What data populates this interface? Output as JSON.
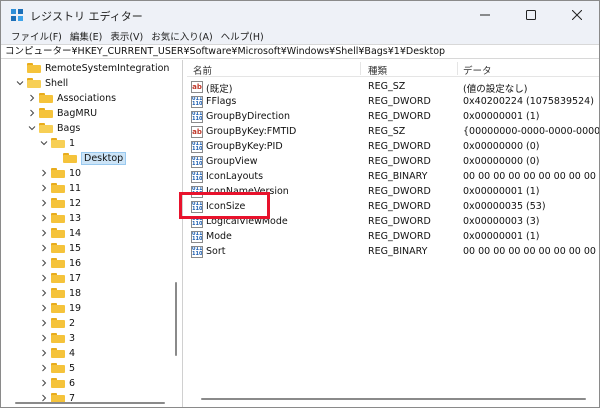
{
  "window": {
    "title": "レジストリ エディター"
  },
  "menu": [
    "ファイル(F)",
    "編集(E)",
    "表示(V)",
    "お気に入り(A)",
    "ヘルプ(H)"
  ],
  "address": "コンピューター¥HKEY_CURRENT_USER¥Software¥Microsoft¥Windows¥Shell¥Bags¥1¥Desktop",
  "tree": [
    {
      "label": "RemoteSystemIntegration",
      "expanded": false,
      "chevron": false
    },
    {
      "label": "Shell",
      "expanded": true,
      "chevron": true
    },
    {
      "label": "Associations",
      "expanded": false,
      "chevron": true
    },
    {
      "label": "BagMRU",
      "expanded": false,
      "chevron": true
    },
    {
      "label": "Bags",
      "expanded": true,
      "chevron": true
    },
    {
      "label": "1",
      "expanded": true,
      "chevron": true
    },
    {
      "label": "Desktop",
      "expanded": false,
      "chevron": false,
      "selected": true
    },
    {
      "label": "10",
      "expanded": false,
      "chevron": true
    },
    {
      "label": "11",
      "expanded": false,
      "chevron": true
    },
    {
      "label": "12",
      "expanded": false,
      "chevron": true
    },
    {
      "label": "13",
      "expanded": false,
      "chevron": true
    },
    {
      "label": "14",
      "expanded": false,
      "chevron": true
    },
    {
      "label": "15",
      "expanded": false,
      "chevron": true
    },
    {
      "label": "16",
      "expanded": false,
      "chevron": true
    },
    {
      "label": "17",
      "expanded": false,
      "chevron": true
    },
    {
      "label": "18",
      "expanded": false,
      "chevron": true
    },
    {
      "label": "19",
      "expanded": false,
      "chevron": true
    },
    {
      "label": "2",
      "expanded": false,
      "chevron": true
    },
    {
      "label": "3",
      "expanded": false,
      "chevron": true
    },
    {
      "label": "4",
      "expanded": false,
      "chevron": true
    },
    {
      "label": "5",
      "expanded": false,
      "chevron": true
    },
    {
      "label": "6",
      "expanded": false,
      "chevron": true
    },
    {
      "label": "7",
      "expanded": false,
      "chevron": true
    }
  ],
  "columns": {
    "name": "名前",
    "type": "種類",
    "data": "データ"
  },
  "values": [
    {
      "name": "(既定)",
      "type": "REG_SZ",
      "data": "(値の設定なし)",
      "icon": "string-value-icon"
    },
    {
      "name": "FFlags",
      "type": "REG_DWORD",
      "data": "0x40200224 (1075839524)",
      "icon": "binary-value-icon"
    },
    {
      "name": "GroupByDirection",
      "type": "REG_DWORD",
      "data": "0x00000001 (1)",
      "icon": "binary-value-icon"
    },
    {
      "name": "GroupByKey:FMTID",
      "type": "REG_SZ",
      "data": "{00000000-0000-0000-0000-000000000000}",
      "icon": "string-value-icon"
    },
    {
      "name": "GroupByKey:PID",
      "type": "REG_DWORD",
      "data": "0x00000000 (0)",
      "icon": "binary-value-icon"
    },
    {
      "name": "GroupView",
      "type": "REG_DWORD",
      "data": "0x00000000 (0)",
      "icon": "binary-value-icon"
    },
    {
      "name": "IconLayouts",
      "type": "REG_BINARY",
      "data": "00 00 00 00 00 00 00 00 00 00 00 00",
      "icon": "binary-value-icon"
    },
    {
      "name": "IconNameVersion",
      "type": "REG_DWORD",
      "data": "0x00000001 (1)",
      "icon": "binary-value-icon"
    },
    {
      "name": "IconSize",
      "type": "REG_DWORD",
      "data": "0x00000035 (53)",
      "icon": "binary-value-icon"
    },
    {
      "name": "LogicalViewMode",
      "type": "REG_DWORD",
      "data": "0x00000003 (3)",
      "icon": "binary-value-icon"
    },
    {
      "name": "Mode",
      "type": "REG_DWORD",
      "data": "0x00000001 (1)",
      "icon": "binary-value-icon"
    },
    {
      "name": "Sort",
      "type": "REG_BINARY",
      "data": "00 00 00 00 00 00 00 00 00 00 00 00",
      "icon": "binary-value-icon"
    }
  ],
  "colors": {
    "highlight_box": "#e8122c",
    "folder": "#f5c33b",
    "selection": "#cce4f7"
  }
}
